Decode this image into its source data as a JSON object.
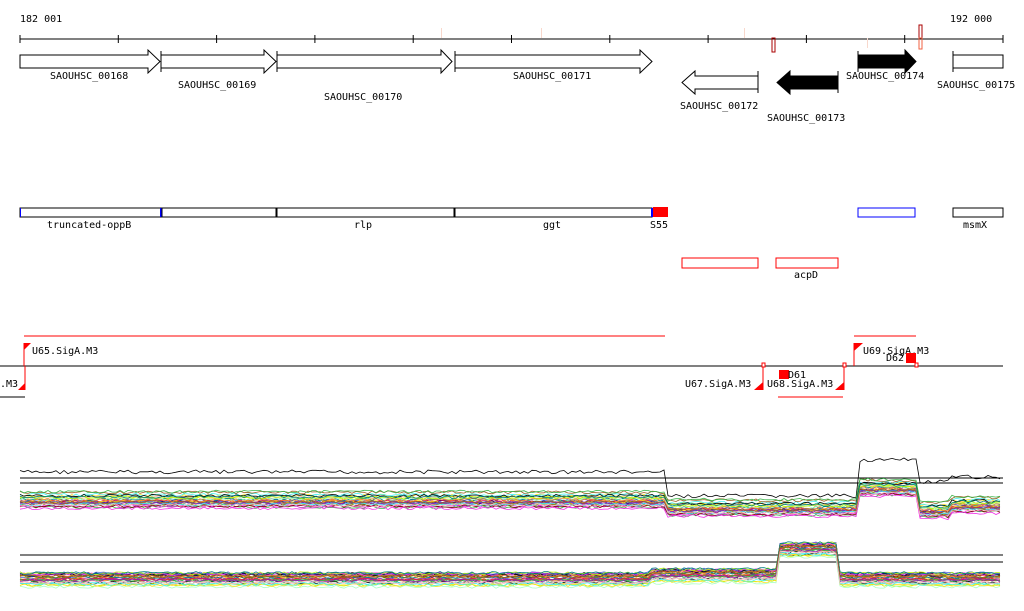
{
  "ruler": {
    "start": "182 001",
    "end": "192 000"
  },
  "genes": [
    {
      "label": "SAOUHSC_00168",
      "strand": "+",
      "fill": "white"
    },
    {
      "label": "SAOUHSC_00169",
      "strand": "+",
      "fill": "white"
    },
    {
      "label": "SAOUHSC_00170",
      "strand": "+",
      "fill": "white"
    },
    {
      "label": "SAOUHSC_00171",
      "strand": "+",
      "fill": "white"
    },
    {
      "label": "SAOUHSC_00172",
      "strand": "-",
      "fill": "white"
    },
    {
      "label": "SAOUHSC_00173",
      "strand": "-",
      "fill": "black"
    },
    {
      "label": "SAOUHSC_00174",
      "strand": "+",
      "fill": "black"
    },
    {
      "label": "SAOUHSC_00175",
      "strand": "+",
      "fill": "white"
    }
  ],
  "operons": {
    "truncated_oppB": "truncated-oppB",
    "rlp": "rlp",
    "ggt": "ggt",
    "s55": "S55",
    "msmX": "msmX",
    "acpD": "acpD"
  },
  "promoters": {
    "u65": "U65.SigA.M3",
    "u66": ".M3",
    "u67": "U67.SigA.M3",
    "u68": "U68.SigA.M3",
    "u69": "U69.SigA.M3",
    "d61": "D61",
    "d62": "D62"
  },
  "colors": {
    "red": "#ff0000",
    "blue": "#0000ff",
    "dark_red": "#aa0000"
  }
}
